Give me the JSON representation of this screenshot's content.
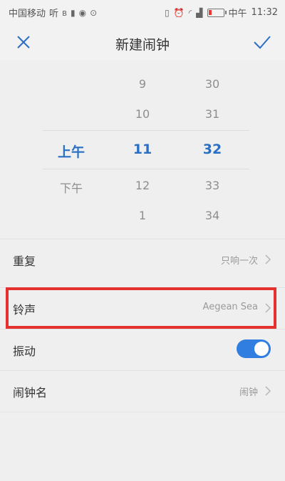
{
  "status_bar": {
    "carrier": "中国移动",
    "carrier_suffix": "听",
    "time_prefix": "中午",
    "time": "11:32"
  },
  "header": {
    "title": "新建闹钟"
  },
  "picker": {
    "ampm": [
      "上午",
      "下午"
    ],
    "hours": [
      "9",
      "10",
      "11",
      "12",
      "1"
    ],
    "minutes": [
      "30",
      "31",
      "32",
      "33",
      "34"
    ],
    "selected": {
      "ampm": "上午",
      "hour": "11",
      "minute": "32"
    }
  },
  "settings": {
    "repeat": {
      "label": "重复",
      "value": "只响一次"
    },
    "ringtone": {
      "label": "铃声",
      "value": "Aegean Sea"
    },
    "vibrate": {
      "label": "振动",
      "on": true
    },
    "alarm_name": {
      "label": "闹钟名",
      "value": "闹钟"
    }
  },
  "colors": {
    "accent": "#2a6fc4",
    "toggle_on": "#2f7ee0",
    "highlight_box": "#e4312d",
    "battery_low": "#e53935"
  }
}
